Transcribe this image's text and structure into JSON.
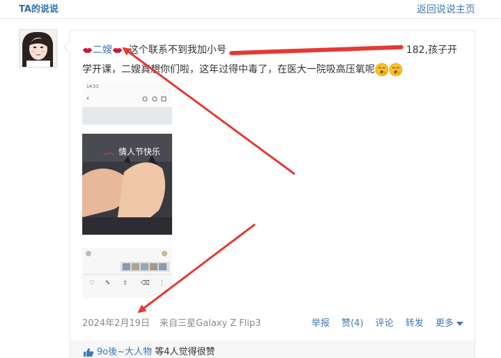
{
  "header": {
    "title": "TA的说说",
    "back_link": "返回说说主页"
  },
  "post": {
    "author": "二嫂",
    "text_before_redaction": "这个联系不到我加小号",
    "text_after_redaction": "182,孩子开学开课，二嫂真想你们啦，这年过得中毒了，在医大一院吸高压氧呢",
    "image1_status": "14:53",
    "image2_caption": "情人节快乐",
    "date": "2024年2月19日",
    "source": "来自三星Galaxy Z Flip3",
    "actions": {
      "report": "举报",
      "like": "赞(4)",
      "comment": "评论",
      "forward": "转发",
      "more": "更多"
    }
  },
  "likes": {
    "liker": "9o後~大人物",
    "suffix": "等4人觉得很赞"
  },
  "colors": {
    "link": "#3b78b5",
    "annotation_red": "#e53935"
  },
  "icons": {
    "lips": "lips-emoji-icon",
    "emoji": "yawn-emoji-icon",
    "thumb": "thumbs-up-icon"
  }
}
